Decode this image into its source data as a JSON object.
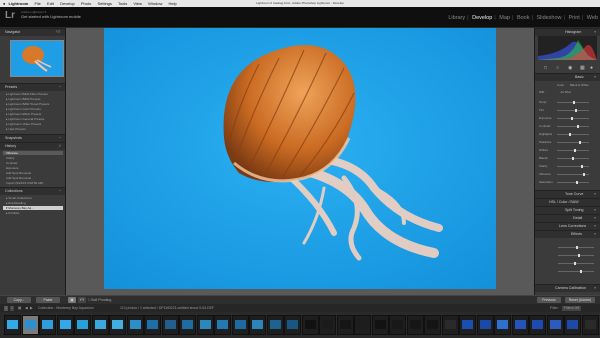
{
  "menubar": {
    "app": "Lightroom",
    "items": [
      "File",
      "Edit",
      "Develop",
      "Photo",
      "Settings",
      "Tools",
      "View",
      "Window",
      "Help"
    ],
    "window_title": "Lightroom 6 Catalog.lrcat - Adobe Photoshop Lightroom - Develop"
  },
  "identity": {
    "logo": "Lr",
    "small_text": "Adobe Lightroom 6",
    "main_text": "Get started with Lightroom mobile"
  },
  "modules": [
    "Library",
    "Develop",
    "Map",
    "Book",
    "Slideshow",
    "Print",
    "Web"
  ],
  "active_module": "Develop",
  "left_panel": {
    "navigator": {
      "title": "Navigator"
    },
    "presets": {
      "title": "Presets",
      "items": [
        "Lightroom B&W Filter Presets",
        "Lightroom B&W Presets",
        "Lightroom B&W Toned Presets",
        "Lightroom Color Presets",
        "Lightroom Effect Presets",
        "Lightroom General Presets",
        "Lightroom Video Presets",
        "User Presets"
      ]
    },
    "snapshots": {
      "title": "Snapshots"
    },
    "history": {
      "title": "History",
      "items": [
        "Vibrance",
        "Clarity",
        "Contrast",
        "Exposure",
        "Add Spot Removal",
        "Add Spot Removal",
        "Import (9/21/15 9:08:56 AM)"
      ]
    },
    "collections": {
      "title": "Collections",
      "items": [
        "Smart Collections",
        "Eva Reading",
        "Monterey Bay Aq...",
        "Portfolio"
      ]
    },
    "copy_label": "Copy...",
    "paste_label": "Paste"
  },
  "right_panel": {
    "histogram": {
      "title": "Histogram"
    },
    "basic": {
      "title": "Basic",
      "treatment": [
        "Color",
        "Black & White"
      ],
      "wb_label": "WB :",
      "wb_value": "As Shot",
      "sliders": [
        "Temp",
        "Tint",
        "Exposure",
        "Contrast",
        "Highlights",
        "Shadows",
        "Whites",
        "Blacks",
        "Clarity",
        "Vibrance",
        "Saturation"
      ]
    },
    "sections": [
      "Tone Curve",
      "HSL / Color / B&W",
      "Split Toning",
      "Detail",
      "Lens Corrections",
      "Effects",
      "Camera Calibration"
    ],
    "previous_label": "Previous",
    "reset_label": "Reset (Adobe)"
  },
  "toolbar": {
    "soft_proofing": "Soft Proofing"
  },
  "filmstrip": {
    "page_1": "1",
    "page_2": "2",
    "path_label": "Collection : Monterey Bay Aquarium",
    "count_label": "113 photos / 1 selected / DP1M0223 untitled shoot 5-53.DEF",
    "filter_label": "Filter:",
    "filter_value": "Filters Off"
  },
  "colors": {
    "accent": "#4aa8e8",
    "panel": "#3b3b3b",
    "center_bg": "#595959",
    "photo_bg": "#1f9ee6"
  }
}
